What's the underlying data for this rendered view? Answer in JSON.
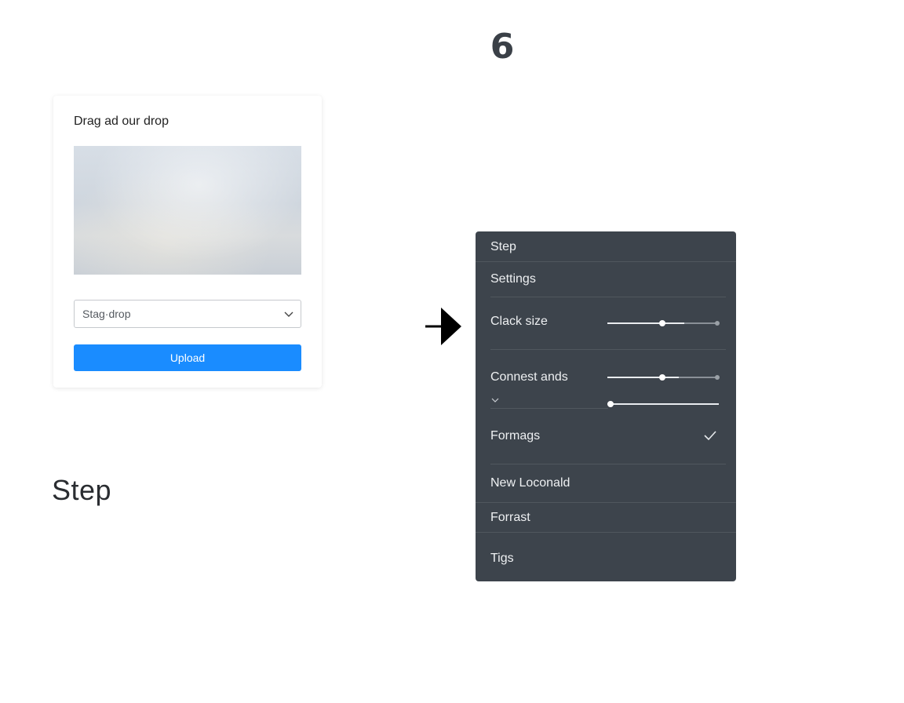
{
  "step_number": "6",
  "upload_card": {
    "title": "Drag ad our drop",
    "select": {
      "value": "Stag·drop"
    },
    "upload_button_label": "Upload"
  },
  "step_caption": "Step",
  "settings_panel": {
    "header": "Step",
    "settings_label": "Settings",
    "clack_size": {
      "label": "Clack size",
      "level": 0.5,
      "secondary": 0.7
    },
    "connest_ands": {
      "label": "Connest ands",
      "level": 0.5,
      "secondary": 0.65
    },
    "extra_slider": {
      "level": 0.03
    },
    "formags": {
      "label": "Formags",
      "checked": true
    },
    "new_loconald": "New Loconald",
    "forrast": "Forrast",
    "tigs": "Tigs"
  },
  "colors": {
    "accent": "#1a8cff",
    "panel_background": "#3d444c",
    "heading_text": "#3a4047"
  },
  "icons": [
    "chevron-down-icon",
    "arrow-right-icon",
    "checkmark-icon"
  ]
}
